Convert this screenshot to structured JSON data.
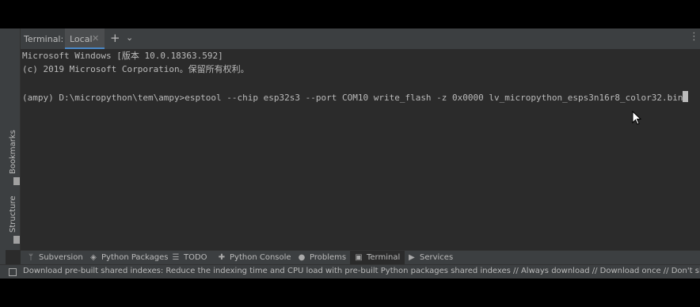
{
  "terminal_header": {
    "title": "Terminal:",
    "tab_label": "Local"
  },
  "side_panels": {
    "bookmarks": "Bookmarks",
    "structure": "Structure"
  },
  "terminal_output": {
    "line1": "Microsoft Windows [版本 10.0.18363.592]",
    "line2": "(c) 2019 Microsoft Corporation。保留所有权利。",
    "prompt_line": "(ampy) D:\\micropython\\tem\\ampy>esptool --chip esp32s3 --port COM10 write_flash -z 0x0000 lv_micropython_esps3n16r8_color32.bin"
  },
  "tool_windows": [
    {
      "label": "Subversion",
      "icon": "subversion-icon"
    },
    {
      "label": "Python Packages",
      "icon": "layers-icon"
    },
    {
      "label": "TODO",
      "icon": "list-icon"
    },
    {
      "label": "Python Console",
      "icon": "python-icon"
    },
    {
      "label": "Problems",
      "icon": "info-icon"
    },
    {
      "label": "Terminal",
      "icon": "terminal-icon"
    },
    {
      "label": "Services",
      "icon": "play-icon"
    }
  ],
  "status_bar": {
    "message": "Download pre-built shared indexes: Reduce the indexing time and CPU load with pre-built Python packages shared indexes // Always download // Download once // Don't show ag"
  }
}
